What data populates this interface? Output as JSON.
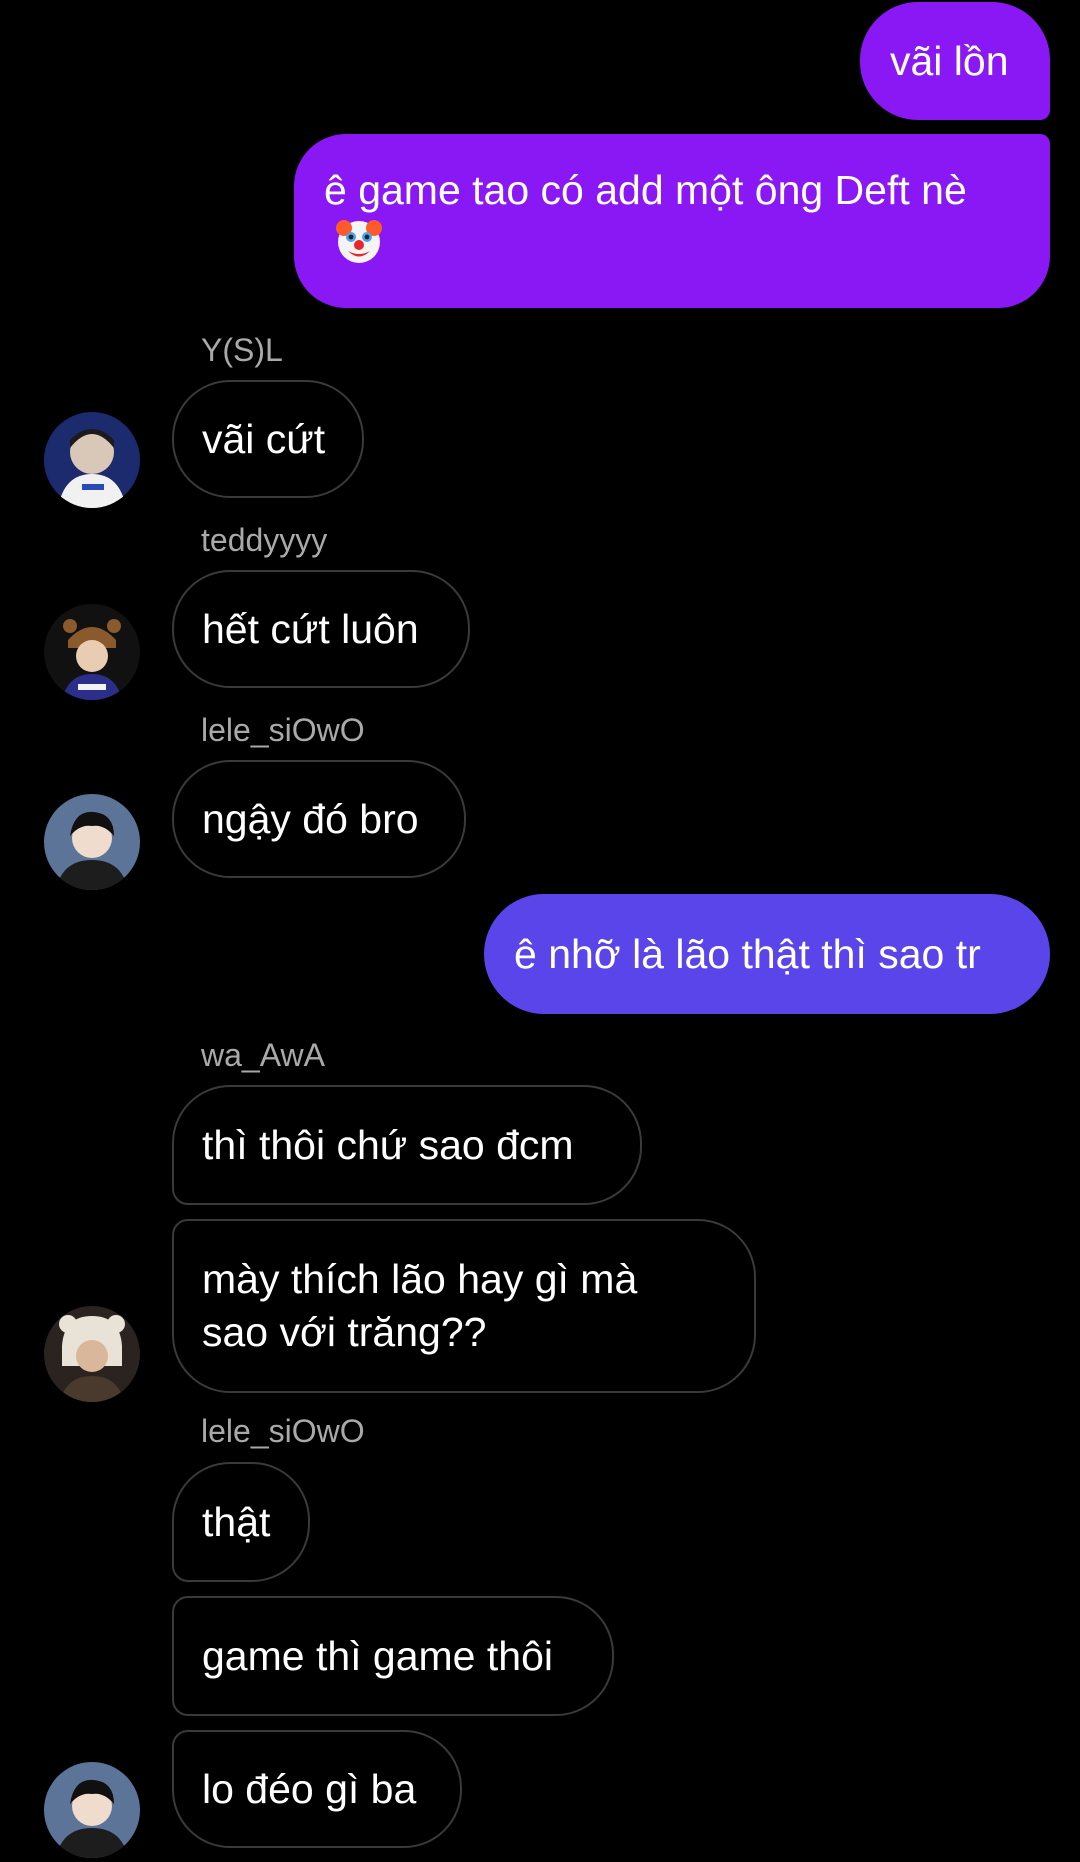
{
  "colors": {
    "background": "#000000",
    "outgoing_purple": "#8a18f5",
    "outgoing_indigo": "#5a45ea",
    "incoming_border": "#3a3a3a",
    "sender_text": "#a9a9a9"
  },
  "messages": {
    "m1": {
      "text": "vãi lồn"
    },
    "m2": {
      "text": "ê game tao có add một ông Deft nè",
      "emoji": "clown-face-icon"
    },
    "m3": {
      "sender": "Y(S)L",
      "text": "vãi cứt"
    },
    "m4": {
      "sender": "teddyyyy",
      "text": "hết cứt luôn"
    },
    "m5": {
      "sender": "lele_siOwO",
      "text": "ngậy đó bro"
    },
    "m6": {
      "text": "ê nhỡ là lão thật thì sao tr"
    },
    "m7": {
      "sender": "wa_AwA",
      "text": "thì thôi chứ sao đcm"
    },
    "m8": {
      "text": "mày thích lão hay gì mà sao với trăng??"
    },
    "m9": {
      "sender": "lele_siOwO",
      "text": "thật"
    },
    "m10": {
      "text": "game thì game thôi"
    },
    "m11": {
      "text": "lo đéo gì ba"
    }
  }
}
